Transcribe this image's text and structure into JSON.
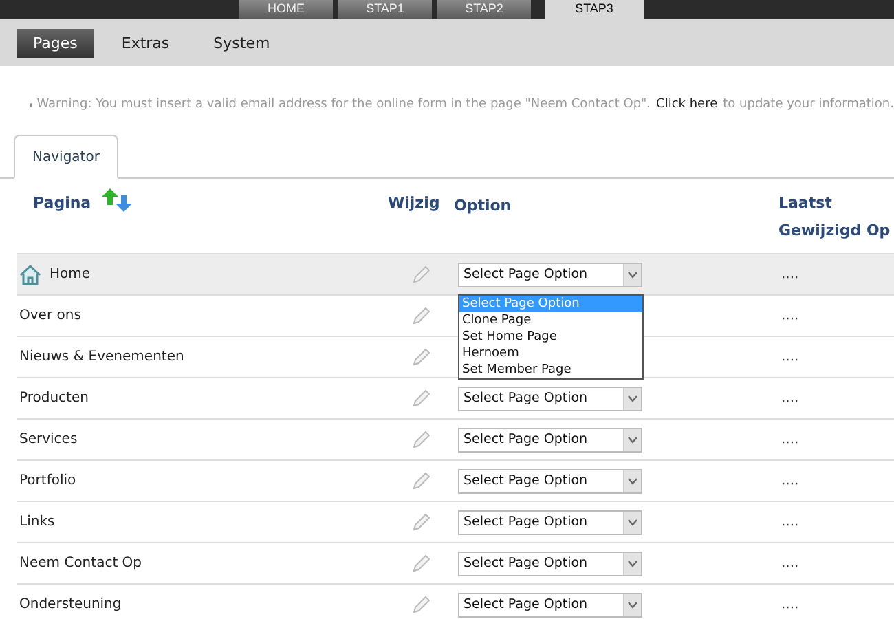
{
  "top_tabs": [
    {
      "label": "HOME",
      "selected": false
    },
    {
      "label": "STAP1",
      "selected": false
    },
    {
      "label": "STAP2",
      "selected": false
    },
    {
      "label": "STAP3",
      "selected": true
    }
  ],
  "sub_tabs": [
    {
      "label": "Pages",
      "selected": true
    },
    {
      "label": "Extras",
      "selected": false
    },
    {
      "label": "System",
      "selected": false
    }
  ],
  "warning": {
    "text": "Warning: You must insert a valid email address for the online form in the page \"Neem Contact Op\".",
    "link": "Click here",
    "rest": "to update your information."
  },
  "panel_tab": {
    "label": "Navigator"
  },
  "table": {
    "columns": [
      "Pagina",
      "Wijzig",
      "Option",
      "Laatst Gewijzigd Op"
    ],
    "rows": [
      {
        "name": "Home",
        "home": true,
        "selected": true,
        "option": "Select Page Option",
        "last": "····",
        "dropdown": {
          "options": [
            {
              "label": "Select Page Option",
              "selected": true
            },
            {
              "label": "Clone Page",
              "selected": false
            },
            {
              "label": "Set Home Page",
              "selected": false
            },
            {
              "label": "Hernoem",
              "selected": false
            },
            {
              "label": "Set Member Page",
              "selected": false
            }
          ]
        }
      },
      {
        "name": "Over ons",
        "home": false,
        "selected": false,
        "last": "····"
      },
      {
        "name": "Nieuws & Evenementen",
        "home": false,
        "selected": false,
        "last": "····"
      },
      {
        "name": "Producten",
        "home": false,
        "selected": false,
        "option": "Select Page Option",
        "last": "····"
      },
      {
        "name": "Services",
        "home": false,
        "selected": false,
        "option": "Select Page Option",
        "last": "····"
      },
      {
        "name": "Portfolio",
        "home": false,
        "selected": false,
        "option": "Select Page Option",
        "last": "····"
      },
      {
        "name": "Links",
        "home": false,
        "selected": false,
        "option": "Select Page Option",
        "last": "····"
      },
      {
        "name": "Neem Contact Op",
        "home": false,
        "selected": false,
        "option": "Select Page Option",
        "last": "····"
      },
      {
        "name": "Ondersteuning",
        "home": false,
        "selected": false,
        "option": "Select Page Option",
        "last": "····"
      }
    ]
  }
}
